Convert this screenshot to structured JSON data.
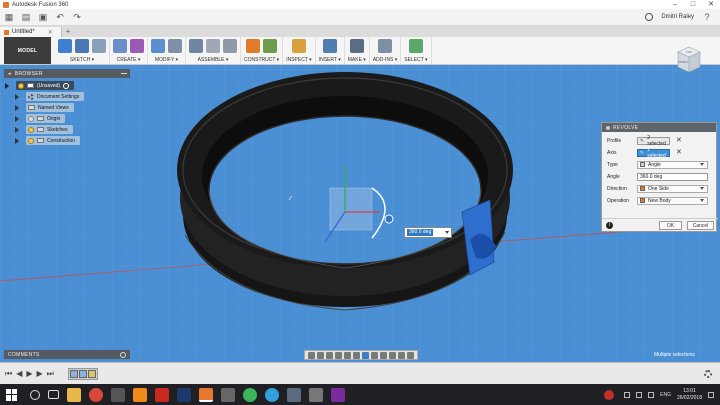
{
  "window": {
    "title": "Autodesk Fusion 360"
  },
  "quick_access": {
    "user": "Dmitri Raley"
  },
  "document_tab": {
    "label": "Untitled*"
  },
  "toolbar": {
    "workspace": "MODEL",
    "groups": [
      {
        "label": "SKETCH ▾",
        "icons": [
          "#3f7fcf",
          "#4a78b5",
          "#8aa0b8"
        ]
      },
      {
        "label": "CREATE ▾",
        "icons": [
          "#6a8fc8",
          "#9b59b6"
        ]
      },
      {
        "label": "MODIFY ▾",
        "icons": [
          "#5b8fd0",
          "#7f8fa5"
        ]
      },
      {
        "label": "ASSEMBLE ▾",
        "icons": [
          "#6f85a0",
          "#a0a8b8",
          "#8f9aa8"
        ]
      },
      {
        "label": "CONSTRUCT ▾",
        "icons": [
          "#e07b2a",
          "#6d9e4e"
        ]
      },
      {
        "label": "INSPECT ▾",
        "icons": [
          "#d9a13b"
        ]
      },
      {
        "label": "INSERT ▾",
        "icons": [
          "#4f7fb0"
        ]
      },
      {
        "label": "MAKE ▾",
        "icons": [
          "#5a6d82"
        ]
      },
      {
        "label": "ADD-INS ▾",
        "icons": [
          "#7e8fa3"
        ]
      },
      {
        "label": "SELECT ▾",
        "icons": [
          "#5aa66b"
        ]
      }
    ]
  },
  "browser": {
    "title": "BROWSER",
    "items": [
      {
        "label": "(Unsaved)"
      },
      {
        "label": "Document Settings"
      },
      {
        "label": "Named Views"
      },
      {
        "label": "Origin"
      },
      {
        "label": "Sketches"
      },
      {
        "label": "Construction"
      }
    ]
  },
  "viewcube": {
    "top": "TOP",
    "front": "FRONT"
  },
  "revolve": {
    "title": "REVOLVE",
    "profile": {
      "label": "Profile",
      "value": "2 selected"
    },
    "axis": {
      "label": "Axis",
      "value": "1 selected"
    },
    "type": {
      "label": "Type",
      "value": "Angle"
    },
    "angle": {
      "label": "Angle",
      "value": "360.0 deg"
    },
    "direction": {
      "label": "Direction",
      "value": "One Side"
    },
    "operation": {
      "label": "Operation",
      "value": "New Body"
    },
    "ok": "OK",
    "cancel": "Cancel"
  },
  "angle_manipulator": {
    "value": "360.0 deg"
  },
  "comments": {
    "title": "COMMENTS"
  },
  "status": {
    "text": "Multiple selections"
  },
  "taskbar": {
    "language": "ENG",
    "time": "13:01",
    "date": "26/02/2018"
  },
  "colors": {
    "canvas": "#4a8fd4",
    "ring_dark": "#141414",
    "revolve_preview": "#2e6fce",
    "dialog_header": "#5d646c"
  }
}
